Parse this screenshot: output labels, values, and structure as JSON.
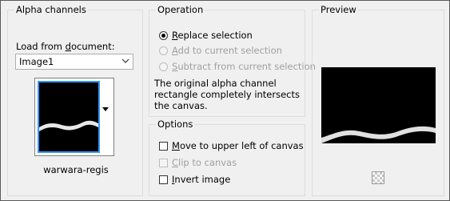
{
  "alpha_channels": {
    "title": "Alpha channels",
    "load_label_pre": "Load from ",
    "load_label_u": "d",
    "load_label_post": "ocument:",
    "document_select_value": "Image1",
    "channel_name": "warwara-regis"
  },
  "operation": {
    "title": "Operation",
    "options": [
      {
        "u": "R",
        "rest": "eplace selection",
        "checked": true,
        "enabled": true
      },
      {
        "u": "A",
        "rest": "dd to current selection",
        "checked": false,
        "enabled": false
      },
      {
        "u": "S",
        "rest": "ubtract from current selection",
        "checked": false,
        "enabled": false
      }
    ],
    "description": "The original alpha channel rectangle completely intersects the canvas."
  },
  "options": {
    "title": "Options",
    "items": [
      {
        "u": "M",
        "rest": "ove to upper left of canvas",
        "checked": false,
        "enabled": true
      },
      {
        "u": "C",
        "rest": "lip to canvas",
        "checked": false,
        "enabled": false
      },
      {
        "u": "I",
        "rest": "nvert image",
        "checked": false,
        "enabled": true
      }
    ]
  },
  "preview": {
    "title": "Preview"
  },
  "icons": {
    "select_arrow": "chevron-down-icon",
    "thumb_dropdown": "triangle-down-icon",
    "checker": "transparency-checker-icon"
  }
}
